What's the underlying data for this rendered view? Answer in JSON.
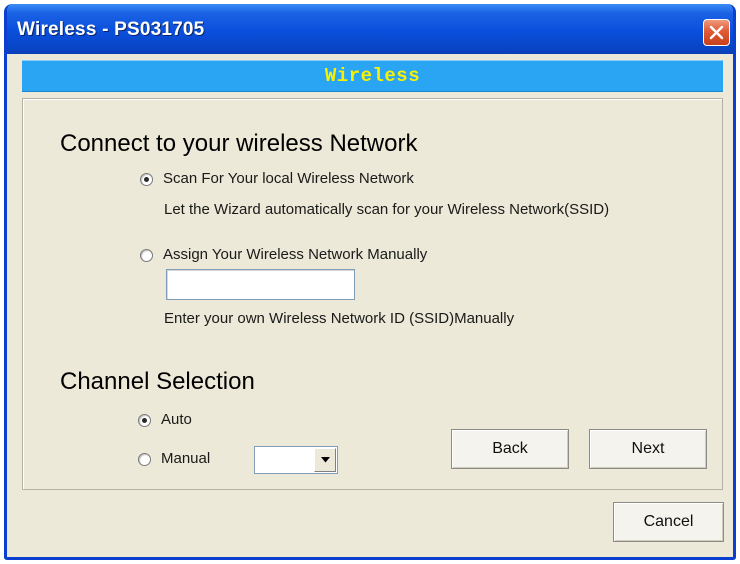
{
  "window": {
    "title": "Wireless - PS031705",
    "close_icon": "close-icon"
  },
  "banner": {
    "text": "Wireless"
  },
  "connect": {
    "heading": "Connect to your wireless Network",
    "scan_label": "Scan For Your local Wireless Network",
    "scan_selected": true,
    "scan_desc": "Let the Wizard automatically scan for your Wireless Network(SSID)",
    "manual_label": "Assign Your Wireless Network Manually",
    "manual_selected": false,
    "ssid_value": "",
    "ssid_desc": "Enter your own Wireless Network ID (SSID)Manually"
  },
  "channel": {
    "heading": "Channel Selection",
    "auto_label": "Auto",
    "auto_selected": true,
    "manual_label": "Manual",
    "manual_selected": false,
    "manual_value": ""
  },
  "buttons": {
    "back": "Back",
    "next": "Next",
    "cancel": "Cancel"
  },
  "colors": {
    "titlebar": "#0a4fdc",
    "banner_bg": "#29a5f4",
    "banner_text": "#f8f100",
    "dialog_bg": "#ece9d8",
    "close_button": "#e05a35"
  }
}
